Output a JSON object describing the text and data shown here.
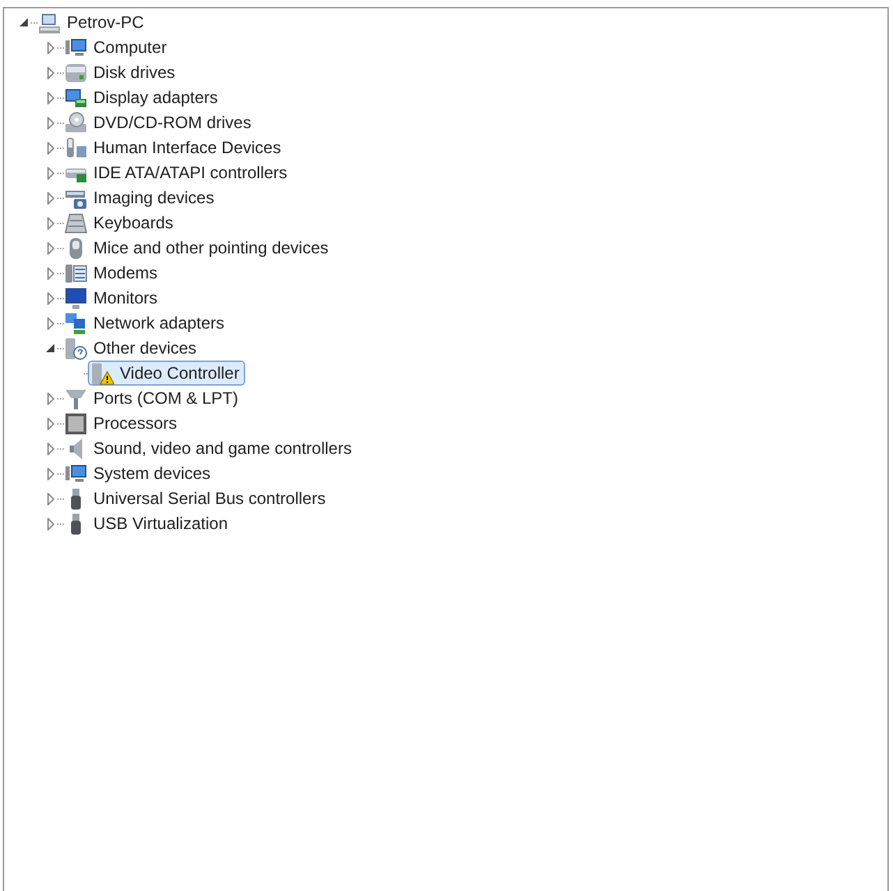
{
  "tree": {
    "label": "Petrov-PC",
    "kind": "pc",
    "expanded": true,
    "selected": false,
    "children": [
      {
        "label": "Computer",
        "kind": "computer",
        "expanded": false,
        "selected": false
      },
      {
        "label": "Disk drives",
        "kind": "disk",
        "expanded": false,
        "selected": false
      },
      {
        "label": "Display adapters",
        "kind": "display",
        "expanded": false,
        "selected": false
      },
      {
        "label": "DVD/CD-ROM drives",
        "kind": "dvd",
        "expanded": false,
        "selected": false
      },
      {
        "label": "Human Interface Devices",
        "kind": "hid",
        "expanded": false,
        "selected": false
      },
      {
        "label": "IDE ATA/ATAPI controllers",
        "kind": "ide",
        "expanded": false,
        "selected": false
      },
      {
        "label": "Imaging devices",
        "kind": "imaging",
        "expanded": false,
        "selected": false
      },
      {
        "label": "Keyboards",
        "kind": "keyboard",
        "expanded": false,
        "selected": false
      },
      {
        "label": "Mice and other pointing devices",
        "kind": "mouse",
        "expanded": false,
        "selected": false
      },
      {
        "label": "Modems",
        "kind": "modem",
        "expanded": false,
        "selected": false
      },
      {
        "label": "Monitors",
        "kind": "monitor",
        "expanded": false,
        "selected": false
      },
      {
        "label": "Network adapters",
        "kind": "network",
        "expanded": false,
        "selected": false
      },
      {
        "label": "Other devices",
        "kind": "unknown",
        "expanded": true,
        "selected": false,
        "children": [
          {
            "label": "Video Controller",
            "kind": "warning",
            "selected": true
          }
        ]
      },
      {
        "label": "Ports (COM & LPT)",
        "kind": "port",
        "expanded": false,
        "selected": false
      },
      {
        "label": "Processors",
        "kind": "processor",
        "expanded": false,
        "selected": false
      },
      {
        "label": "Sound, video and game controllers",
        "kind": "sound",
        "expanded": false,
        "selected": false
      },
      {
        "label": "System devices",
        "kind": "computer",
        "expanded": false,
        "selected": false
      },
      {
        "label": "Universal Serial Bus controllers",
        "kind": "usb",
        "expanded": false,
        "selected": false
      },
      {
        "label": "USB Virtualization",
        "kind": "usb",
        "expanded": false,
        "selected": false
      }
    ]
  }
}
